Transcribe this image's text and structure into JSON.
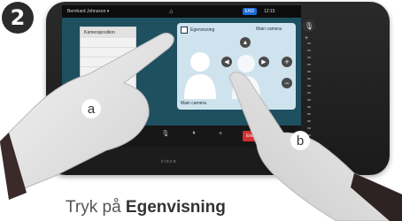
{
  "step": "2",
  "device": {
    "topbar": {
      "caller": "Bernhard Johnsson ▾",
      "home_icon": "home-icon",
      "call_badge": "END",
      "clock": "12:15"
    },
    "list_panel": {
      "header": "Kameraposition",
      "rows": [
        "",
        "",
        "",
        ""
      ]
    },
    "selfview": {
      "title": "Egenvisning",
      "main_label": "Main camera",
      "caption": "Main camera"
    },
    "brand": "cisco",
    "end_call_label": "End call"
  },
  "hand_labels": {
    "left": "a",
    "right": "b"
  },
  "caption": {
    "prefix": "Tryk på ",
    "bold": "Egenvisning"
  }
}
